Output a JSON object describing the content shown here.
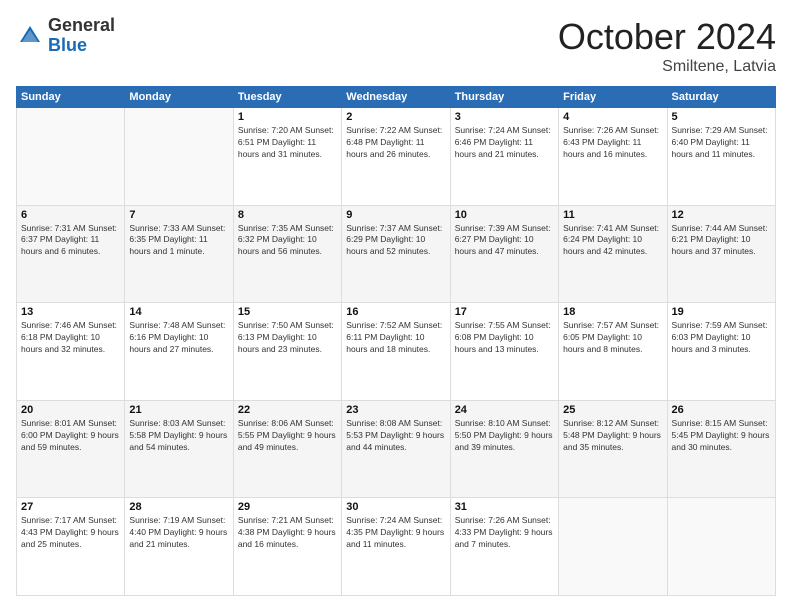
{
  "logo": {
    "general": "General",
    "blue": "Blue"
  },
  "title": "October 2024",
  "location": "Smiltene, Latvia",
  "days_of_week": [
    "Sunday",
    "Monday",
    "Tuesday",
    "Wednesday",
    "Thursday",
    "Friday",
    "Saturday"
  ],
  "weeks": [
    [
      {
        "day": "",
        "info": ""
      },
      {
        "day": "",
        "info": ""
      },
      {
        "day": "1",
        "info": "Sunrise: 7:20 AM\nSunset: 6:51 PM\nDaylight: 11 hours and 31 minutes."
      },
      {
        "day": "2",
        "info": "Sunrise: 7:22 AM\nSunset: 6:48 PM\nDaylight: 11 hours and 26 minutes."
      },
      {
        "day": "3",
        "info": "Sunrise: 7:24 AM\nSunset: 6:46 PM\nDaylight: 11 hours and 21 minutes."
      },
      {
        "day": "4",
        "info": "Sunrise: 7:26 AM\nSunset: 6:43 PM\nDaylight: 11 hours and 16 minutes."
      },
      {
        "day": "5",
        "info": "Sunrise: 7:29 AM\nSunset: 6:40 PM\nDaylight: 11 hours and 11 minutes."
      }
    ],
    [
      {
        "day": "6",
        "info": "Sunrise: 7:31 AM\nSunset: 6:37 PM\nDaylight: 11 hours and 6 minutes."
      },
      {
        "day": "7",
        "info": "Sunrise: 7:33 AM\nSunset: 6:35 PM\nDaylight: 11 hours and 1 minute."
      },
      {
        "day": "8",
        "info": "Sunrise: 7:35 AM\nSunset: 6:32 PM\nDaylight: 10 hours and 56 minutes."
      },
      {
        "day": "9",
        "info": "Sunrise: 7:37 AM\nSunset: 6:29 PM\nDaylight: 10 hours and 52 minutes."
      },
      {
        "day": "10",
        "info": "Sunrise: 7:39 AM\nSunset: 6:27 PM\nDaylight: 10 hours and 47 minutes."
      },
      {
        "day": "11",
        "info": "Sunrise: 7:41 AM\nSunset: 6:24 PM\nDaylight: 10 hours and 42 minutes."
      },
      {
        "day": "12",
        "info": "Sunrise: 7:44 AM\nSunset: 6:21 PM\nDaylight: 10 hours and 37 minutes."
      }
    ],
    [
      {
        "day": "13",
        "info": "Sunrise: 7:46 AM\nSunset: 6:18 PM\nDaylight: 10 hours and 32 minutes."
      },
      {
        "day": "14",
        "info": "Sunrise: 7:48 AM\nSunset: 6:16 PM\nDaylight: 10 hours and 27 minutes."
      },
      {
        "day": "15",
        "info": "Sunrise: 7:50 AM\nSunset: 6:13 PM\nDaylight: 10 hours and 23 minutes."
      },
      {
        "day": "16",
        "info": "Sunrise: 7:52 AM\nSunset: 6:11 PM\nDaylight: 10 hours and 18 minutes."
      },
      {
        "day": "17",
        "info": "Sunrise: 7:55 AM\nSunset: 6:08 PM\nDaylight: 10 hours and 13 minutes."
      },
      {
        "day": "18",
        "info": "Sunrise: 7:57 AM\nSunset: 6:05 PM\nDaylight: 10 hours and 8 minutes."
      },
      {
        "day": "19",
        "info": "Sunrise: 7:59 AM\nSunset: 6:03 PM\nDaylight: 10 hours and 3 minutes."
      }
    ],
    [
      {
        "day": "20",
        "info": "Sunrise: 8:01 AM\nSunset: 6:00 PM\nDaylight: 9 hours and 59 minutes."
      },
      {
        "day": "21",
        "info": "Sunrise: 8:03 AM\nSunset: 5:58 PM\nDaylight: 9 hours and 54 minutes."
      },
      {
        "day": "22",
        "info": "Sunrise: 8:06 AM\nSunset: 5:55 PM\nDaylight: 9 hours and 49 minutes."
      },
      {
        "day": "23",
        "info": "Sunrise: 8:08 AM\nSunset: 5:53 PM\nDaylight: 9 hours and 44 minutes."
      },
      {
        "day": "24",
        "info": "Sunrise: 8:10 AM\nSunset: 5:50 PM\nDaylight: 9 hours and 39 minutes."
      },
      {
        "day": "25",
        "info": "Sunrise: 8:12 AM\nSunset: 5:48 PM\nDaylight: 9 hours and 35 minutes."
      },
      {
        "day": "26",
        "info": "Sunrise: 8:15 AM\nSunset: 5:45 PM\nDaylight: 9 hours and 30 minutes."
      }
    ],
    [
      {
        "day": "27",
        "info": "Sunrise: 7:17 AM\nSunset: 4:43 PM\nDaylight: 9 hours and 25 minutes."
      },
      {
        "day": "28",
        "info": "Sunrise: 7:19 AM\nSunset: 4:40 PM\nDaylight: 9 hours and 21 minutes."
      },
      {
        "day": "29",
        "info": "Sunrise: 7:21 AM\nSunset: 4:38 PM\nDaylight: 9 hours and 16 minutes."
      },
      {
        "day": "30",
        "info": "Sunrise: 7:24 AM\nSunset: 4:35 PM\nDaylight: 9 hours and 11 minutes."
      },
      {
        "day": "31",
        "info": "Sunrise: 7:26 AM\nSunset: 4:33 PM\nDaylight: 9 hours and 7 minutes."
      },
      {
        "day": "",
        "info": ""
      },
      {
        "day": "",
        "info": ""
      }
    ]
  ]
}
